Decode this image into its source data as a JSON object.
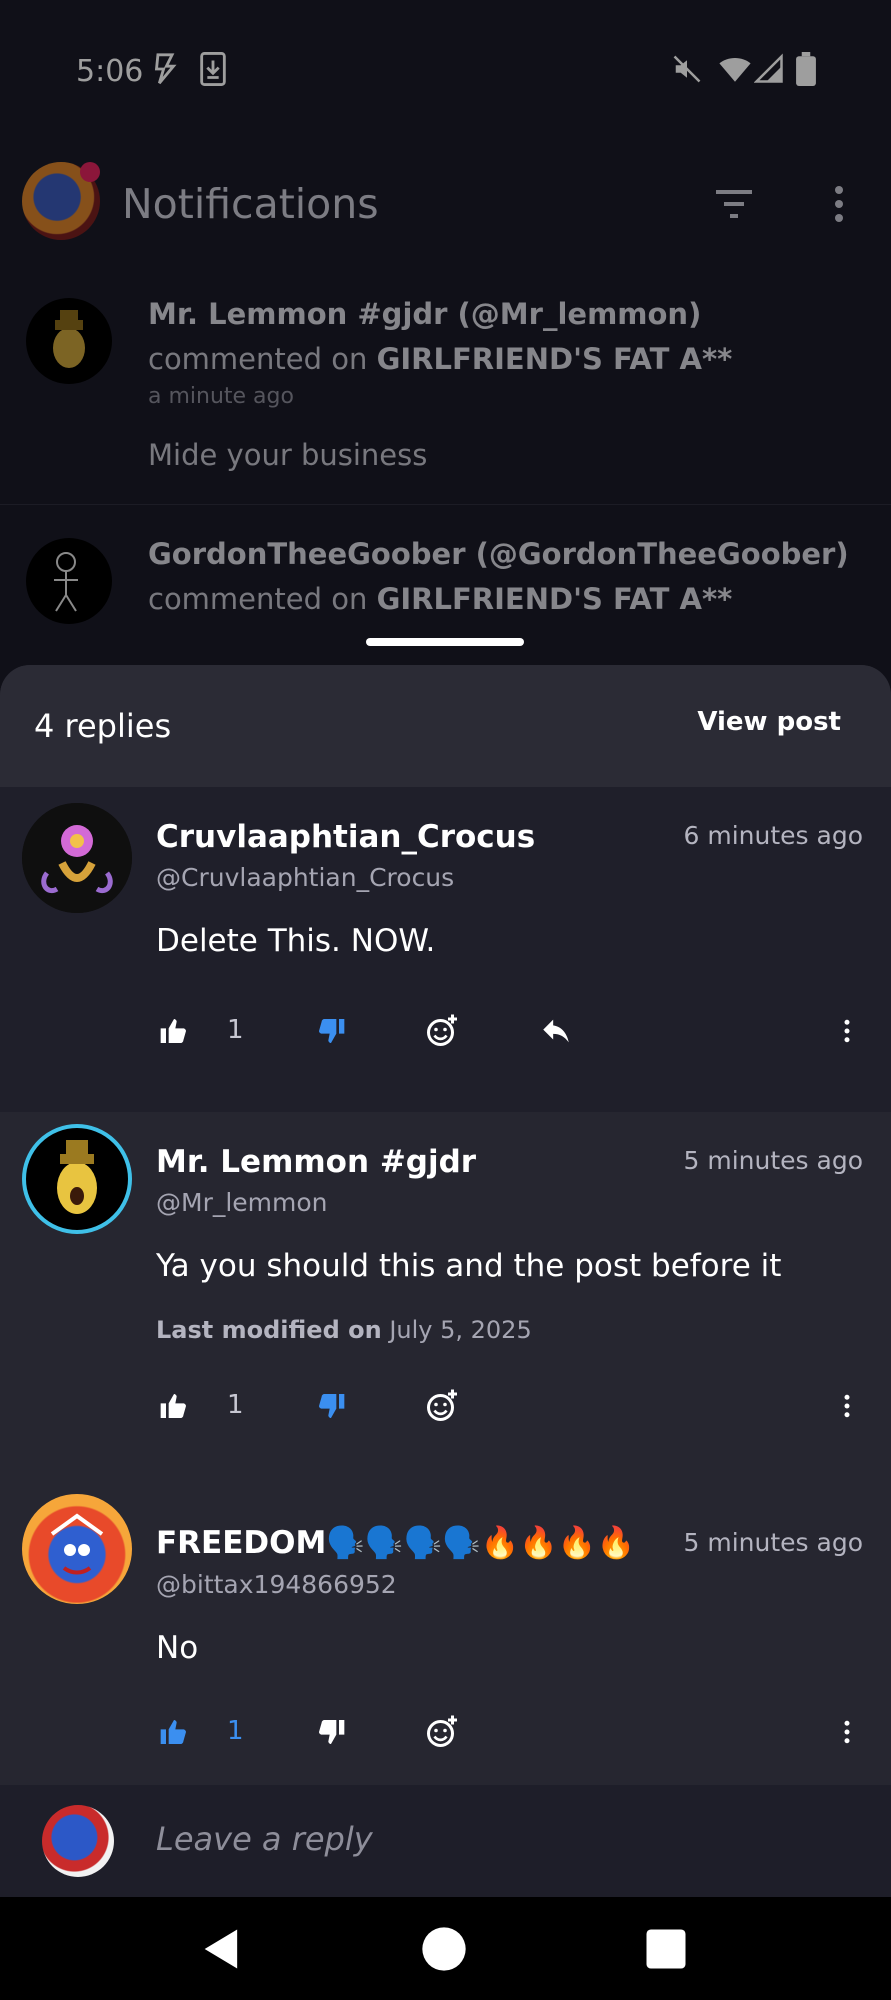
{
  "status_bar": {
    "time": "5:06"
  },
  "header": {
    "title": "Notifications"
  },
  "notifications": [
    {
      "user": "Mr. Lemmon #gjdr (@Mr_lemmon)",
      "action": "commented on",
      "target": "GIRLFRIEND'S FAT A**",
      "time": "a minute ago",
      "body": "Mide your business"
    },
    {
      "user": "GordonTheeGoober (@GordonTheeGoober)",
      "action": "commented on",
      "target": "GIRLFRIEND'S FAT A**"
    }
  ],
  "sheet": {
    "replies_label": "4 replies",
    "view_post_label": "View post"
  },
  "comments": [
    {
      "name": "Cruvlaaphtian_Crocus",
      "handle": "@Cruvlaaphtian_Crocus",
      "time": "6 minutes ago",
      "body": "Delete This. NOW.",
      "likes": "1"
    },
    {
      "name": "Mr. Lemmon #gjdr",
      "handle": "@Mr_lemmon",
      "time": "5 minutes ago",
      "body": "Ya you should this and the post before it",
      "modified_label": "Last modified on",
      "modified_date": "July 5, 2025",
      "likes": "1"
    },
    {
      "name": "FREEDOM🗣️🗣️🗣️🗣️🔥🔥🔥🔥",
      "handle": "@bittax194866952",
      "time": "5 minutes ago",
      "body": "No",
      "likes": "1"
    }
  ],
  "reply": {
    "placeholder": "Leave a reply"
  },
  "colors": {
    "accent_blue": "#3b8ff0",
    "sheet_bg": "#262630",
    "highlight_bg": "#1f1f2a"
  }
}
